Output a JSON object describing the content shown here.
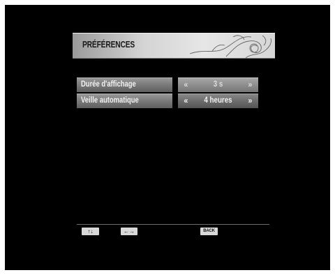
{
  "header": {
    "title": "PRÉFÉRENCES"
  },
  "settings": [
    {
      "label": "Durée d'affichage",
      "value": "3 s"
    },
    {
      "label": "Veille automatique",
      "value": "4 heures"
    }
  ],
  "footer": {
    "back_label": "BACK",
    "updown_glyph": "↑↓",
    "leftright_glyph": "←→"
  },
  "colors": {
    "background": "#000000",
    "panel": "#7a7a7a",
    "highlight": "#d9d9d9"
  },
  "icons": [
    "arrow-up-down-icon",
    "arrow-left-right-icon",
    "back-key-icon",
    "double-chevron-left-icon",
    "double-chevron-right-icon",
    "swirl-ornament-icon"
  ]
}
